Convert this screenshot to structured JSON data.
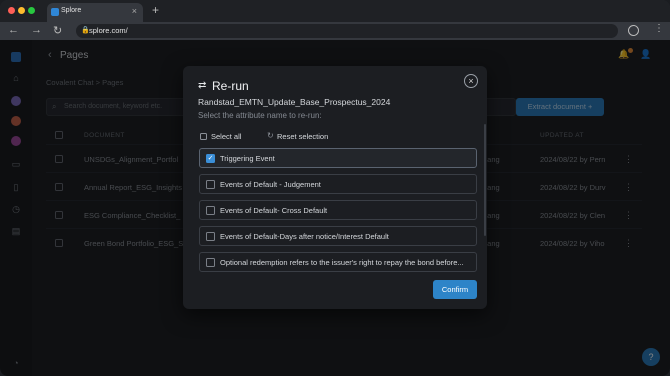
{
  "browser": {
    "tab_title": "Splore",
    "url": "splore.com/"
  },
  "app": {
    "header_title": "Pages",
    "breadcrumb": "Covalent Chat  >  Pages",
    "search_placeholder": "Search document, keyword etc.",
    "extract_button": "Extract document  +",
    "table": {
      "columns": [
        "DOCUMENT",
        "UPDATED AT"
      ],
      "rows": [
        {
          "document": "UNSDGs_Alignment_Portfol",
          "user": "hang",
          "updated": "2024/08/22 by Pern"
        },
        {
          "document": "Annual Report_ESG_Insights",
          "user": "hang",
          "updated": "2024/08/22 by Durv"
        },
        {
          "document": "ESG Compliance_Checklist_",
          "user": "hang",
          "updated": "2024/08/22 by Clen"
        },
        {
          "document": "Green Bond Portfolio_ESG_S",
          "user": "hang",
          "updated": "2024/08/22 by Viho"
        }
      ]
    },
    "help_label": "?"
  },
  "modal": {
    "title": "Re-run",
    "document_name": "Randstad_EMTN_Update_Base_Prospectus_2024",
    "subtitle": "Select the attribute name to re-run:",
    "select_all": "Select all",
    "reset": "Reset selection",
    "options": [
      {
        "label": "Triggering Event",
        "checked": true
      },
      {
        "label": "Events of Default - Judgement",
        "checked": false
      },
      {
        "label": "Events of Default- Cross Default",
        "checked": false
      },
      {
        "label": "Events of Default-Days after notice/Interest Default",
        "checked": false
      },
      {
        "label": "Optional redemption refers to the issuer's right to repay the bond before...",
        "checked": false
      }
    ],
    "confirm": "Confirm"
  },
  "colors": {
    "accent": "#2d84c8",
    "background": "#1d2024",
    "modal_bg": "#1c1e22"
  }
}
